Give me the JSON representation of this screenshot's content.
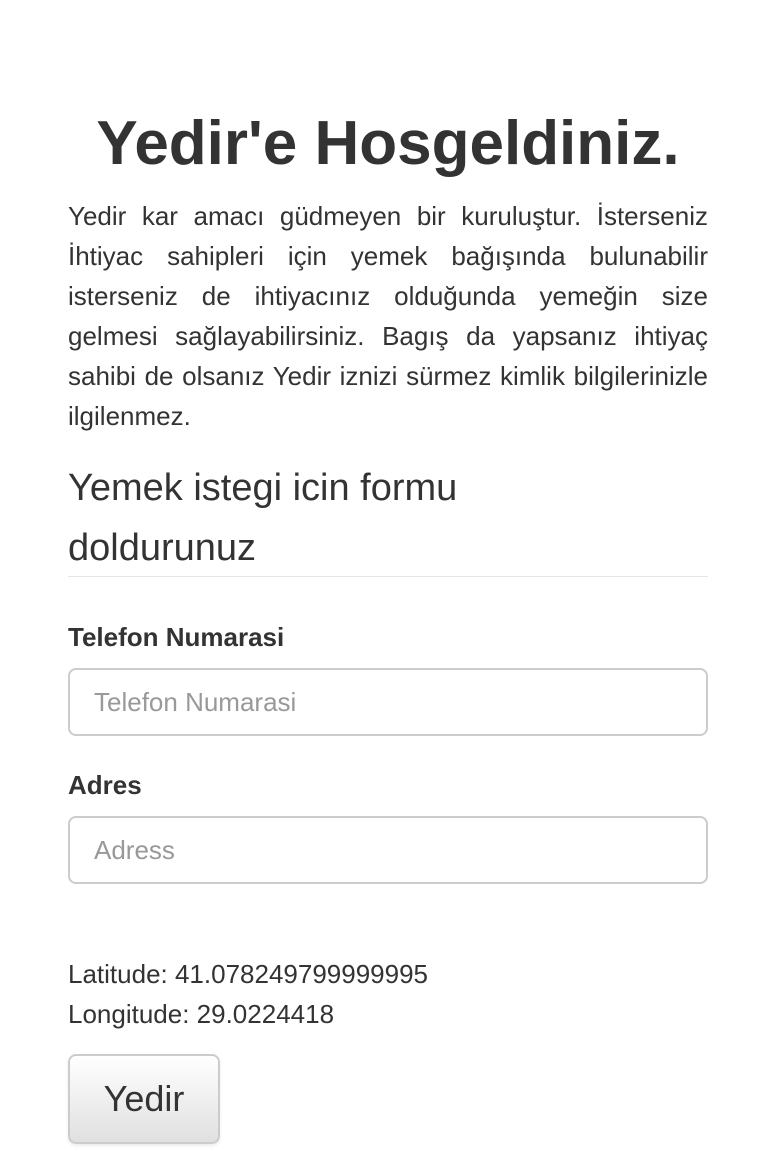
{
  "header": {
    "title": "Yedir'e Hosgeldiniz."
  },
  "intro": {
    "text": "Yedir kar amacı güdmeyen bir kuruluştur. İsterseniz İhtiyac sahipleri için yemek bağışında bulunabilir isterseniz de ihtiyacınız olduğunda yemeğin size gelmesi sağlayabilirsiniz. Bagış da yapsanız ihtiyaç sahibi de olsanız Yedir iznizi sürmez kimlik bilgilerinizle ilgilenmez."
  },
  "form": {
    "heading": "Yemek istegi icin formu doldurunuz",
    "phone": {
      "label": "Telefon Numarasi",
      "placeholder": "Telefon Numarasi",
      "value": ""
    },
    "address": {
      "label": "Adres",
      "placeholder": "Adress",
      "value": ""
    },
    "location": {
      "latitude_text": "Latitude: 41.078249799999995",
      "longitude_text": "Longitude: 29.0224418"
    },
    "submit_label": "Yedir"
  }
}
